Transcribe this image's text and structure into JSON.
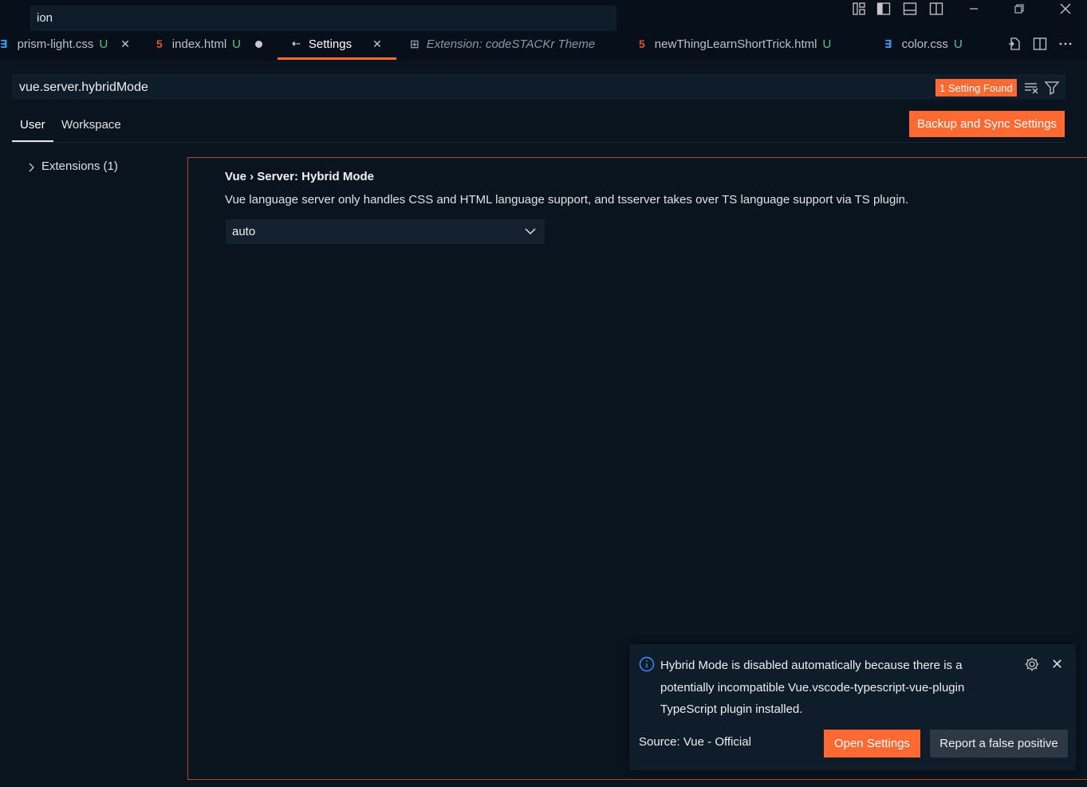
{
  "title_bar": {
    "command_input_value": "ion",
    "layout_icons": [
      "customize-layout-icon",
      "toggle-primary-sidebar-icon",
      "toggle-panel-icon",
      "toggle-secondary-sidebar-icon"
    ],
    "window_controls": [
      "minimize-icon",
      "restore-icon",
      "close-icon"
    ]
  },
  "tabs": [
    {
      "label": "prism-light.css",
      "status": "U",
      "file_type": "css",
      "icon": "css-file-icon"
    },
    {
      "label": "index.html",
      "status": "U",
      "file_type": "html",
      "icon": "html-file-icon"
    },
    {
      "label": "Settings",
      "active": true,
      "icon": "settings-icon"
    },
    {
      "label": "Extension: codeSTACKr Theme",
      "preview": true,
      "icon": "extension-icon"
    },
    {
      "label": "newThingLearnShortTrick.html",
      "status": "U",
      "file_type": "html",
      "icon": "html-file-icon"
    },
    {
      "label": "color.css",
      "status": "U",
      "file_type": "css",
      "icon": "css-file-icon"
    }
  ],
  "editor_actions": [
    "open-settings-json-icon",
    "split-editor-icon",
    "more-actions-icon"
  ],
  "settings": {
    "search_value": "vue.server.hybridMode",
    "found_badge": "1 Setting Found",
    "scopes": [
      "User",
      "Workspace"
    ],
    "active_scope": "User",
    "backup_button": "Backup and Sync Settings",
    "tree": [
      {
        "label": "Extensions (1)",
        "expanded": false
      }
    ],
    "setting": {
      "title": "Vue › Server: Hybrid Mode",
      "description": "Vue language server only handles CSS and HTML language support, and tsserver takes over TS language support via TS plugin.",
      "value": "auto"
    }
  },
  "notification": {
    "message": "Hybrid Mode is disabled automatically because there is a potentially incompatible Vue.vscode-typescript-vue-plugin TypeScript plugin installed.",
    "source": "Source: Vue - Official",
    "primary_button": "Open Settings",
    "secondary_button": "Report a false positive"
  },
  "colors": {
    "accent": "#ff6a33",
    "background": "#0a141f",
    "input_background": "#0f1c29",
    "css_icon": "#3d8fe0",
    "html_icon": "#e4532a",
    "untracked": "#5fbf8a",
    "info_icon": "#3794ff"
  }
}
